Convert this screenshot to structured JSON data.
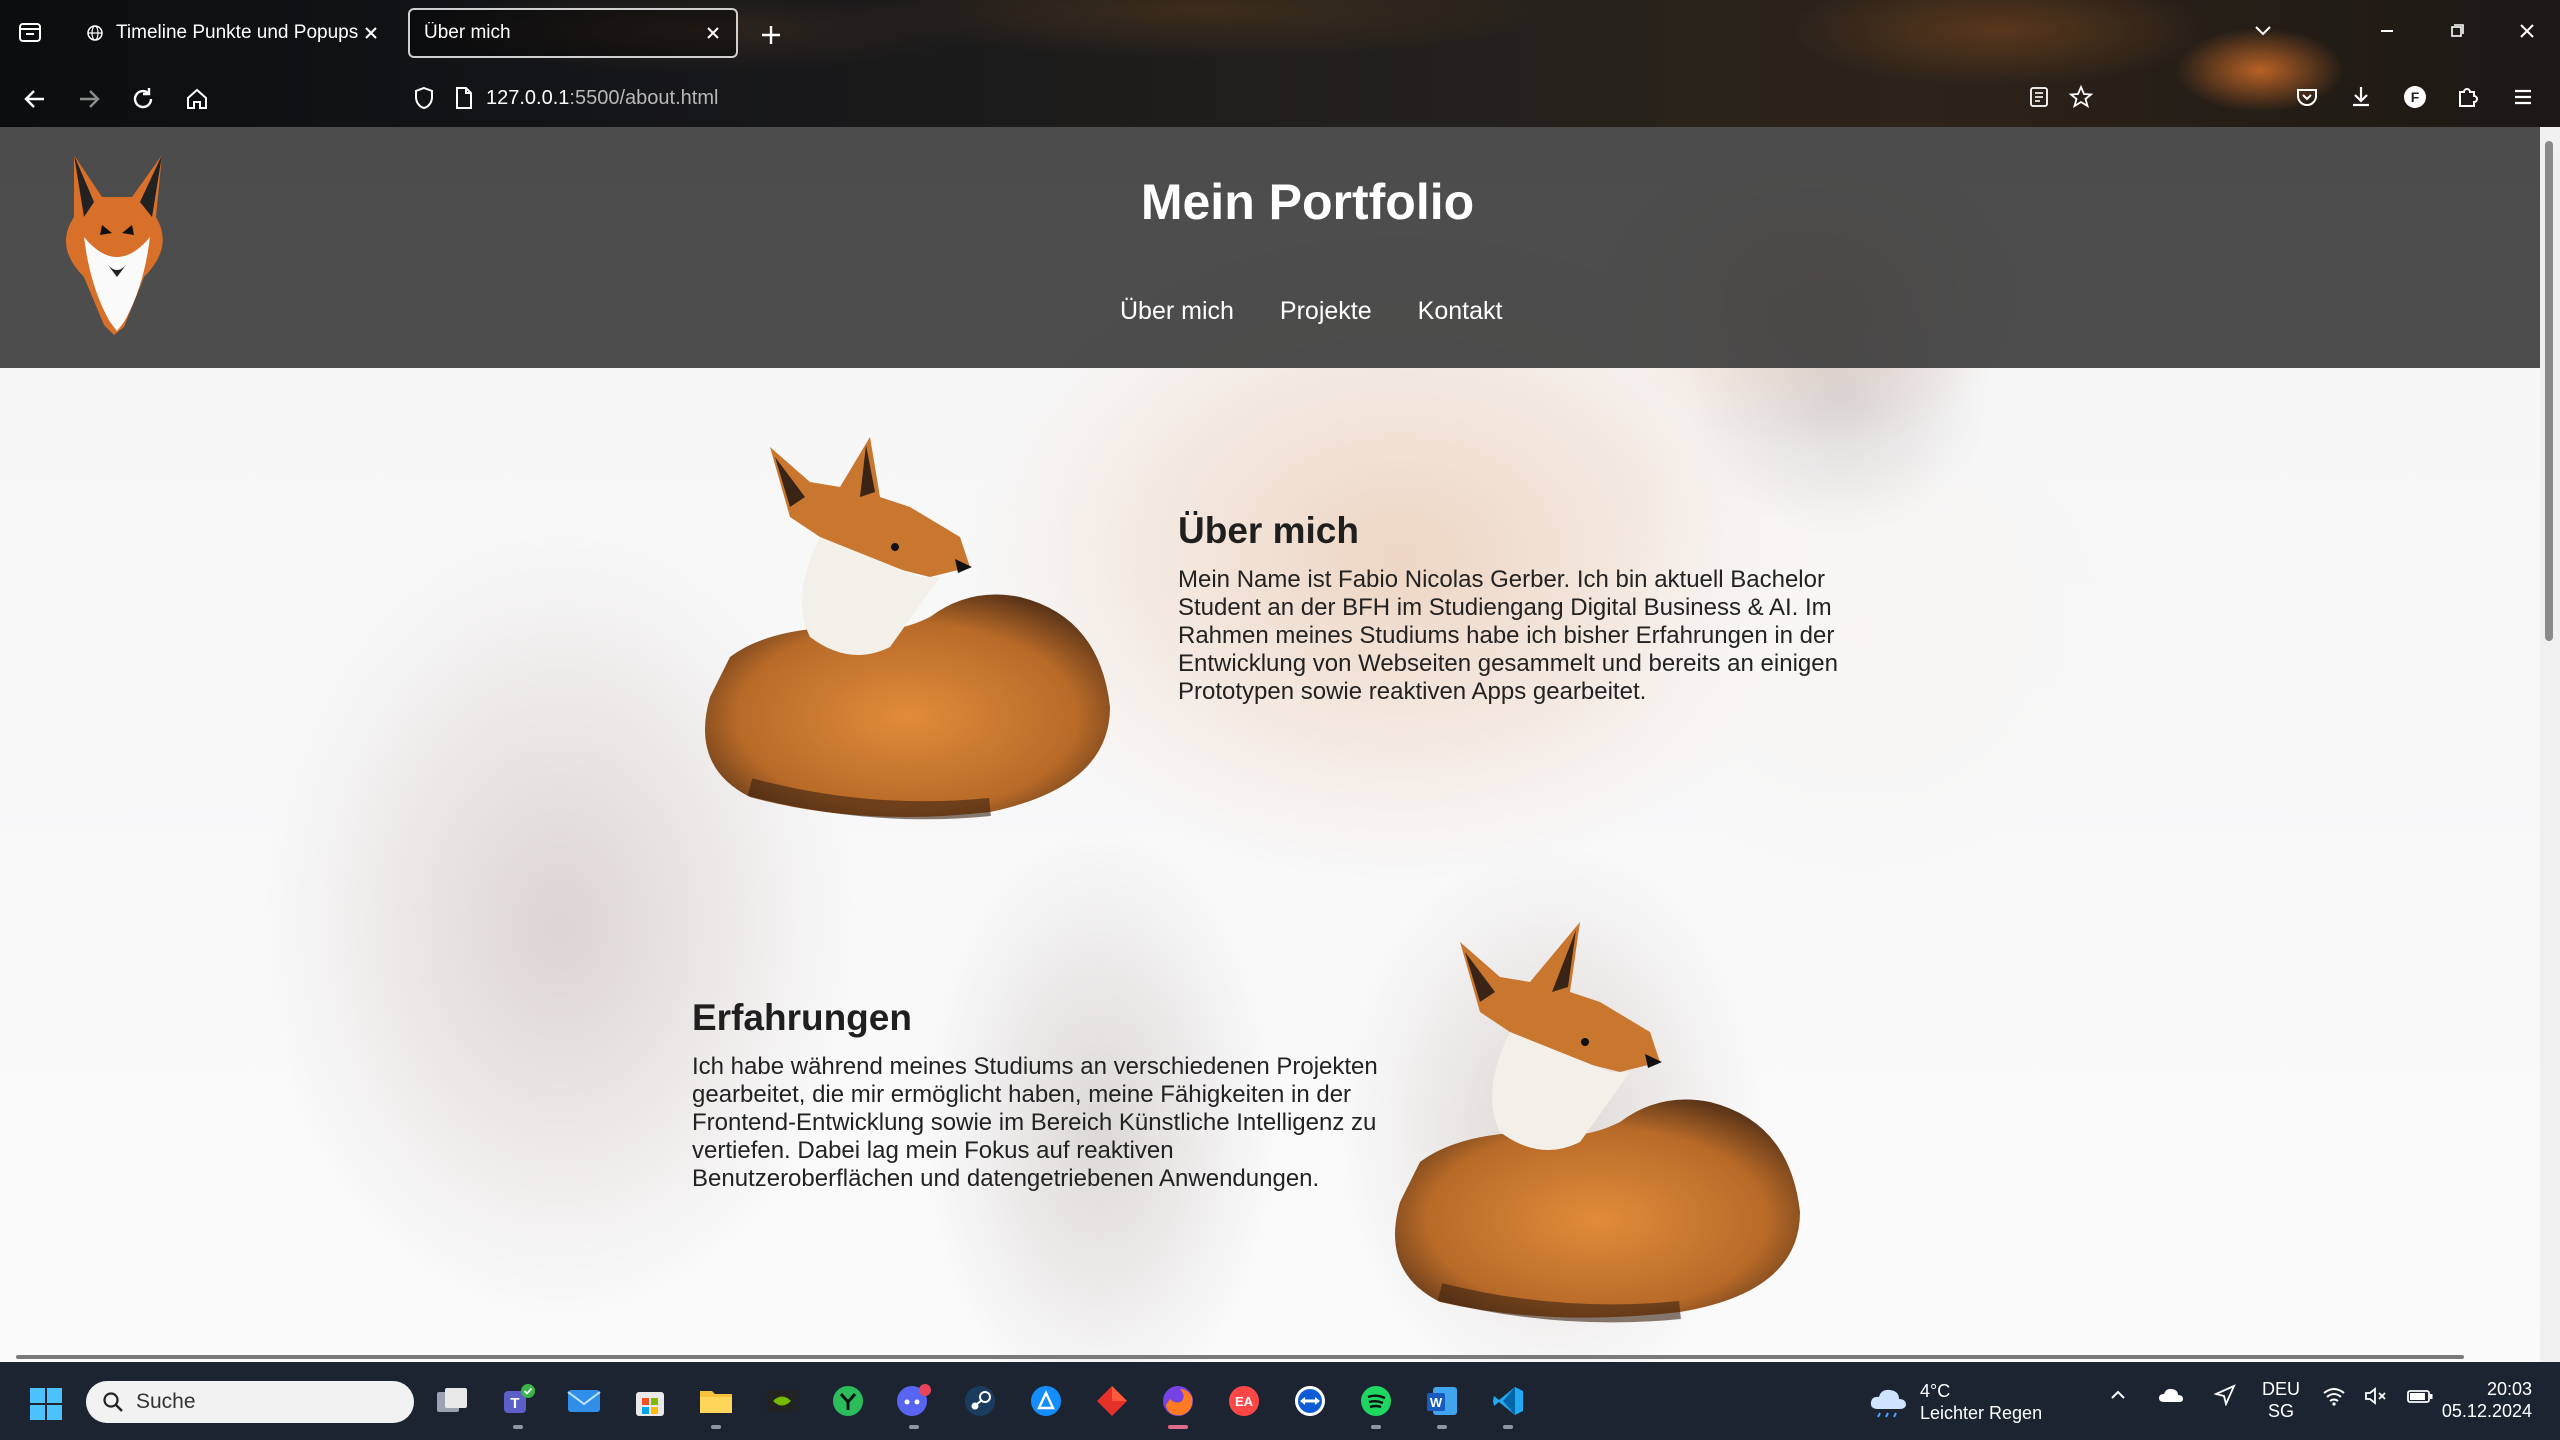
{
  "browser": {
    "tabs": [
      {
        "title": "Timeline Punkte und Popups",
        "active": false
      },
      {
        "title": "Über mich",
        "active": true
      }
    ],
    "url_host": "127.0.0.1",
    "url_path": ":5500/about.html"
  },
  "site": {
    "title": "Mein Portfolio",
    "nav": [
      "Über mich",
      "Projekte",
      "Kontakt"
    ],
    "about": {
      "heading": "Über mich",
      "text": "Mein Name ist Fabio Nicolas Gerber. Ich bin aktuell Bachelor Student an der BFH im Studiengang Digital Business & AI. Im Rahmen meines Studiums habe ich bisher Erfahrungen in der Entwicklung von Webseiten gesammelt und bereits an einigen Prototypen sowie reaktiven Apps gearbeitet."
    },
    "experience": {
      "heading": "Erfahrungen",
      "text": "Ich habe während meines Studiums an verschiedenen Projekten gearbeitet, die mir ermöglicht haben, meine Fähigkeiten in der Frontend-Entwicklung sowie im Bereich Künstliche Intelligenz zu vertiefen. Dabei lag mein Fokus auf reaktiven Benutzeroberflächen und datengetriebenen Anwendungen."
    }
  },
  "taskbar": {
    "search_placeholder": "Suche",
    "weather_temp": "4°C",
    "weather_desc": "Leichter Regen",
    "lang_line1": "DEU",
    "lang_line2": "SG",
    "time": "20:03",
    "date": "05.12.2024"
  },
  "colors": {
    "header_bg": "#3a3a3a",
    "taskbar_bg": "#1c2432",
    "fox_orange": "#d4782c"
  }
}
